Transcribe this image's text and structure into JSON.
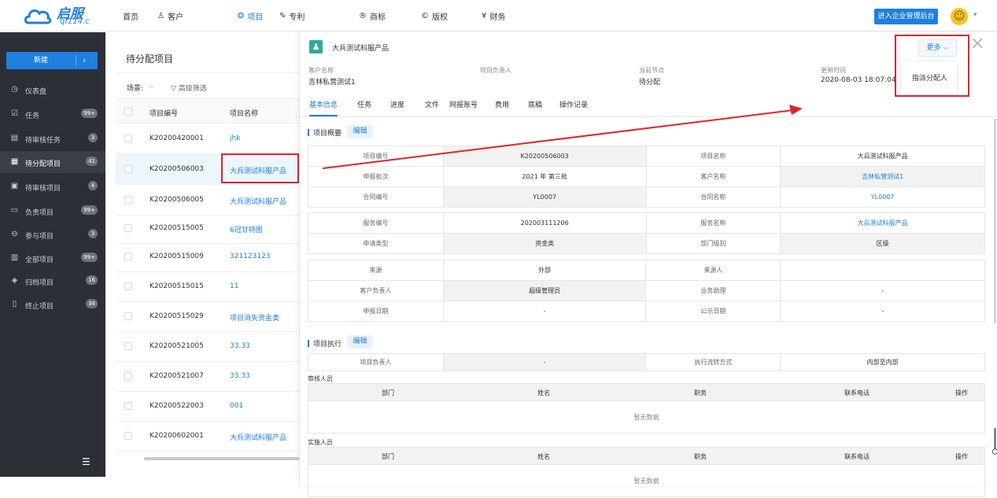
{
  "brand": {
    "name_cn": "启服",
    "domain_text": "qf114.c"
  },
  "nav": [
    {
      "label": "首页",
      "icon": ""
    },
    {
      "label": "客户",
      "icon": "user-icon"
    },
    {
      "label": "项目",
      "icon": "project-icon"
    },
    {
      "label": "专利",
      "icon": "patent-icon"
    },
    {
      "label": "商标",
      "icon": "trademark-icon"
    },
    {
      "label": "版权",
      "icon": "copyright-icon"
    },
    {
      "label": "财务",
      "icon": "finance-icon"
    }
  ],
  "header": {
    "enter_admin": "进入企业管理后台"
  },
  "sidebar": {
    "new_label": "新建",
    "items": [
      {
        "label": "仪表盘",
        "badge": ""
      },
      {
        "label": "任务",
        "badge": "99+"
      },
      {
        "label": "待审核任务",
        "badge": "3"
      },
      {
        "label": "待分配项目",
        "badge": "41"
      },
      {
        "label": "待审核项目",
        "badge": "4"
      },
      {
        "label": "负责项目",
        "badge": "99+"
      },
      {
        "label": "参与项目",
        "badge": "3"
      },
      {
        "label": "全部项目",
        "badge": "99+"
      },
      {
        "label": "归档项目",
        "badge": "16"
      },
      {
        "label": "终止项目",
        "badge": "34"
      }
    ]
  },
  "list": {
    "title": "待分配项目",
    "scene_label": "场景:",
    "scene_caret": "⌵",
    "advanced_filter": "高级筛选",
    "col_code": "项目编号",
    "col_name": "项目名称",
    "rows": [
      {
        "code": "K20200420001",
        "name": "jhk"
      },
      {
        "code": "K20200506003",
        "name": "大兵测试科服产品"
      },
      {
        "code": "K20200506005",
        "name": "大兵测试科服产品"
      },
      {
        "code": "K20200515005",
        "name": "6冠甘特图"
      },
      {
        "code": "K20200515009",
        "name": "321123123"
      },
      {
        "code": "K20200515015",
        "name": "11"
      },
      {
        "code": "K20200515029",
        "name": "项目消失资金类"
      },
      {
        "code": "K20200521005",
        "name": "33.33"
      },
      {
        "code": "K20200521007",
        "name": "33.33"
      },
      {
        "code": "K20200522003",
        "name": "001"
      },
      {
        "code": "K20200602001",
        "name": "大兵测试科服产品"
      }
    ]
  },
  "detail": {
    "title": "大兵测试科服产品",
    "more": "更多 ⌵",
    "dropdown_item": "指派分配人",
    "meta": [
      {
        "label": "客户名称",
        "value": "吉林私营测试1"
      },
      {
        "label": "项目负责人",
        "value": ""
      },
      {
        "label": "当前节点",
        "value": "待分配"
      },
      {
        "label": "更新时间",
        "value": "2020-08-03 18:07:04"
      }
    ],
    "tabs": [
      "基本信息",
      "任务",
      "进度",
      "文件",
      "网报账号",
      "费用",
      "底稿",
      "操作记录"
    ],
    "overview": {
      "title": "项目概要",
      "edit": "编辑",
      "group1": [
        [
          "项目编号",
          "K20200506003",
          "项目名称",
          "大兵测试科服产品"
        ],
        [
          "申报批次",
          "2021 年 第三批",
          "客户名称",
          "吉林私营测试1"
        ],
        [
          "合同编号",
          "YL0007",
          "合同名称",
          "YL0007"
        ]
      ],
      "group2": [
        [
          "服务编号",
          "202003111206",
          "服务名称",
          "大兵测试科服产品"
        ],
        [
          "申请类型",
          "资金类",
          "部门级别",
          "区级"
        ]
      ],
      "group3": [
        [
          "来源",
          "外部",
          "来源人",
          ""
        ],
        [
          "客户负责人",
          "超级管理员",
          "业务助理",
          "-"
        ],
        [
          "申报日期",
          "-",
          "公示日期",
          "-"
        ]
      ]
    },
    "execution": {
      "title": "项目执行",
      "edit": "编辑",
      "row": [
        "项目负责人",
        "-",
        "执行流转方式",
        "内部至内部"
      ],
      "reviewers_label": "审核人员",
      "implementers_label": "实施人员",
      "cols": [
        "部门",
        "姓名",
        "职务",
        "联系电话",
        "操作"
      ],
      "empty": "暂无数据"
    }
  },
  "colors": {
    "accent": "#1e7fe0",
    "sidebar_bg": "#2c2f36",
    "annotation_red": "#e0252a"
  }
}
